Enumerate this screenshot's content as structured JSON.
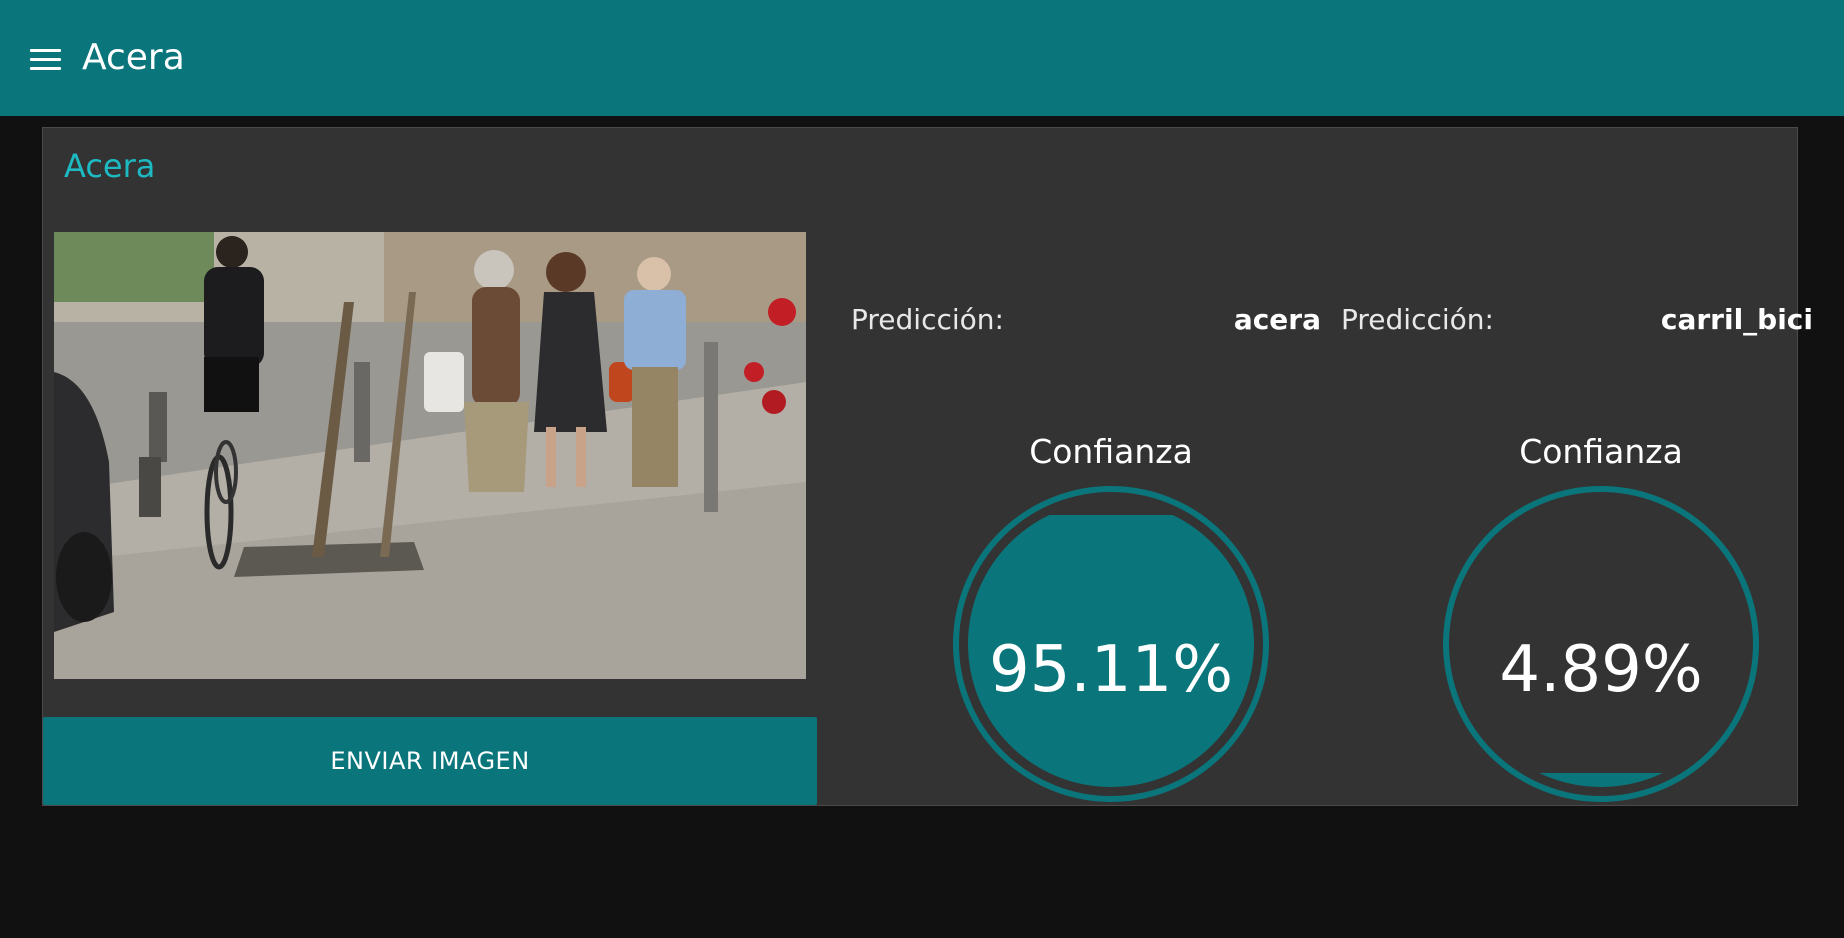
{
  "header": {
    "menu_icon": "hamburger-menu-icon",
    "title": "Acera"
  },
  "card": {
    "title": "Acera",
    "image_alt": "street sidewalk with pedestrians and cyclist",
    "send_button": "ENVIAR IMAGEN"
  },
  "predictions": [
    {
      "label": "Predicción:",
      "value": "acera",
      "confidence_label": "Confianza",
      "confidence_text": "95.11%",
      "confidence": 0.9511
    },
    {
      "label": "Predicción:",
      "value": "carril_bici",
      "confidence_label": "Confianza",
      "confidence_text": "4.89%",
      "confidence": 0.0489
    }
  ],
  "colors": {
    "accent": "#0a767b",
    "title_accent": "#1dbac3",
    "card_bg": "#333333",
    "page_bg": "#111111"
  }
}
